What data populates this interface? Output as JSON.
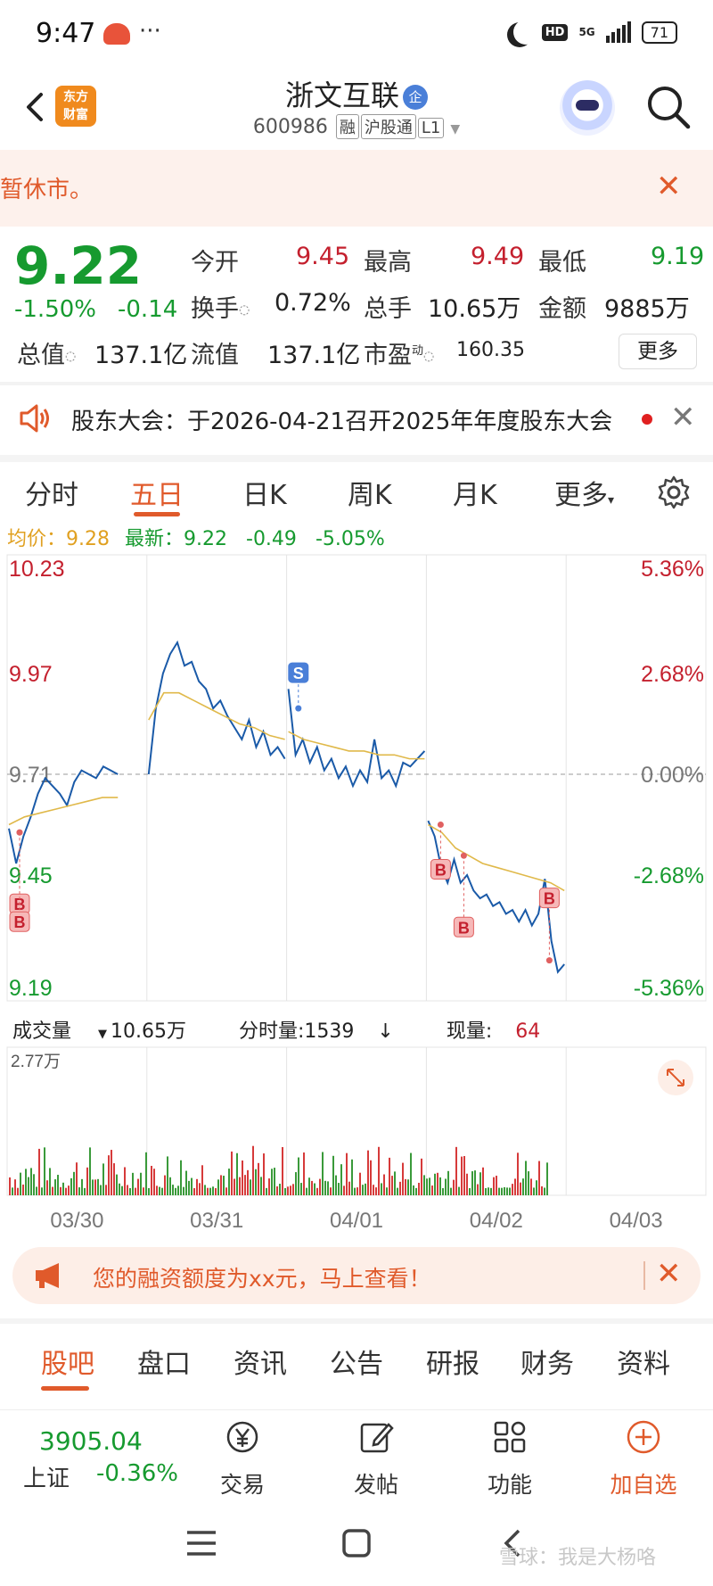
{
  "status_bar": {
    "time": "9:47",
    "dots": "···",
    "network": "5G",
    "battery": "71",
    "hd": "HD"
  },
  "header": {
    "stock_name": "浙文互联",
    "ent_badge": "企",
    "stock_code": "600986",
    "tags": [
      "融",
      "沪股通",
      "L1"
    ],
    "brand_line1": "东方",
    "brand_line2": "财富"
  },
  "notice": {
    "text": "暂休市。"
  },
  "quote": {
    "price": "9.22",
    "change_pct": "-1.50%",
    "change_amt": "-0.14",
    "open_label": "今开",
    "open": "9.45",
    "high_label": "最高",
    "high": "9.49",
    "low_label": "最低",
    "low": "9.19",
    "turnover_label": "换手",
    "turnover": "0.72%",
    "volume_label": "总手",
    "volume": "10.65万",
    "amount_label": "金额",
    "amount": "9885万",
    "mktcap_label": "总值",
    "mktcap": "137.1亿",
    "float_label": "流值",
    "float_cap": "137.1亿",
    "pe_label": "市盈",
    "pe_sup": "动",
    "pe": "160.35",
    "more_label": "更多"
  },
  "meeting": {
    "text": "股东大会：于2026-04-21召开2025年年度股东大会"
  },
  "tabs": [
    "分时",
    "五日",
    "日K",
    "周K",
    "月K",
    "更多"
  ],
  "legend": {
    "avg_label": "均价：",
    "avg": "9.28",
    "latest_label": "最新：",
    "latest": "9.22",
    "chg": "-0.49",
    "chg_pct": "-5.05%"
  },
  "vol_legend": {
    "label": "成交量",
    "total": "10.65万",
    "tick_label": "分时量:1539",
    "arrow": "↓",
    "now_label": "现量:",
    "now": "64"
  },
  "chart_data": {
    "type": "line",
    "title": "",
    "x_labels": [
      "03/30",
      "03/31",
      "04/01",
      "04/02",
      "04/03"
    ],
    "y_left_ticks": [
      "10.23",
      "9.97",
      "9.71",
      "9.45",
      "9.19"
    ],
    "y_right_ticks": [
      "5.36%",
      "2.68%",
      "0.00%",
      "-2.68%",
      "-5.36%"
    ],
    "prev_close": 9.71,
    "ylim": [
      9.19,
      10.23
    ],
    "volume_max_label": "2.77万",
    "series": [
      {
        "day": "03/30",
        "price": [
          9.57,
          9.48,
          9.55,
          9.6,
          9.66,
          9.7,
          9.68,
          9.66,
          9.63,
          9.69,
          9.72,
          9.71,
          9.7,
          9.73,
          9.72,
          9.71
        ],
        "avg": [
          9.58,
          9.6,
          9.61,
          9.62,
          9.63,
          9.64,
          9.65,
          9.65
        ]
      },
      {
        "day": "03/31",
        "price": [
          9.71,
          9.88,
          9.97,
          10.02,
          10.05,
          9.99,
          10.0,
          9.95,
          9.93,
          9.88,
          9.9,
          9.86,
          9.83,
          9.8,
          9.85,
          9.78,
          9.82,
          9.76,
          9.78,
          9.75
        ],
        "avg": [
          9.85,
          9.92,
          9.92,
          9.9,
          9.88,
          9.86,
          9.84,
          9.83,
          9.81,
          9.8
        ]
      },
      {
        "day": "04/01",
        "price": [
          9.93,
          9.76,
          9.8,
          9.74,
          9.78,
          9.72,
          9.75,
          9.7,
          9.73,
          9.68,
          9.72,
          9.69,
          9.8,
          9.7,
          9.72,
          9.68,
          9.74,
          9.73,
          9.75,
          9.77
        ],
        "avg": [
          9.82,
          9.8,
          9.79,
          9.78,
          9.77,
          9.77,
          9.76,
          9.76,
          9.75,
          9.75
        ]
      },
      {
        "day": "04/02",
        "price": [
          9.59,
          9.55,
          9.47,
          9.43,
          9.49,
          9.43,
          9.45,
          9.41,
          9.39,
          9.4,
          9.37,
          9.38,
          9.35,
          9.36,
          9.33,
          9.36,
          9.32,
          9.35,
          9.44,
          9.28,
          9.2,
          9.22
        ],
        "avg": [
          9.58,
          9.56,
          9.52,
          9.5,
          9.48,
          9.47,
          9.46,
          9.45,
          9.44,
          9.43,
          9.41
        ]
      }
    ],
    "markers": [
      {
        "label": "B",
        "day": "03/30",
        "price": 9.56
      },
      {
        "label": "B",
        "day": "03/30",
        "price": 9.56
      },
      {
        "label": "S",
        "day": "03/31",
        "price": 9.88
      },
      {
        "label": "B",
        "day": "04/02",
        "price": 9.58
      },
      {
        "label": "B",
        "day": "04/02",
        "price": 9.5
      },
      {
        "label": "B",
        "day": "04/02",
        "price": 9.23
      }
    ]
  },
  "promo": {
    "text": "您的融资额度为xx元，马上查看！"
  },
  "sub_tabs": [
    "股吧",
    "盘口",
    "资讯",
    "公告",
    "研报",
    "财务",
    "资料"
  ],
  "bottom_nav": {
    "index_value": "3905.04",
    "index_name": "上证",
    "index_chg": "-0.36%",
    "items": [
      "交易",
      "发帖",
      "功能",
      "加自选"
    ]
  },
  "watermark": "雪球：我是大杨咯",
  "colors": {
    "accent": "#e05a2b",
    "up": "#c4202e",
    "down": "#169a2f",
    "line": "#1a5aa8",
    "avg": "#e0b94a"
  }
}
